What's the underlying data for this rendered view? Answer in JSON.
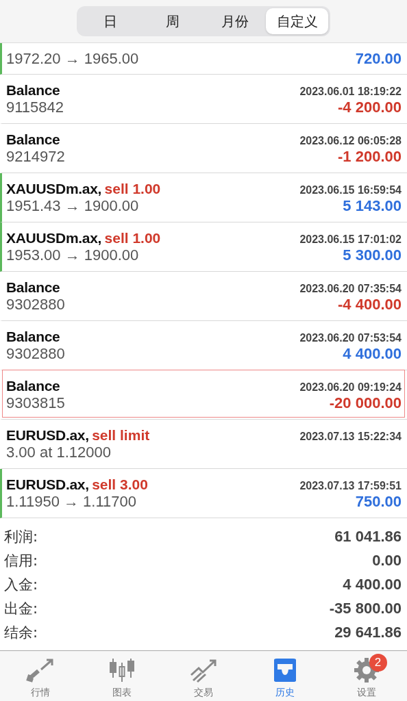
{
  "periods": [
    {
      "label": "日",
      "selected": false
    },
    {
      "label": "周",
      "selected": false
    },
    {
      "label": "月份",
      "selected": false
    },
    {
      "label": "自定义",
      "selected": true
    }
  ],
  "deals": [
    {
      "kind": "deal",
      "partial": true,
      "selected": false,
      "detail": "1972.20 → 1965.00",
      "amount": "720.00",
      "loss": false
    },
    {
      "kind": "balance",
      "selected": false,
      "symbol": "Balance",
      "time": "2023.06.01 18:19:22",
      "detail": "9115842",
      "amount": "-4 200.00",
      "loss": true
    },
    {
      "kind": "balance",
      "selected": false,
      "symbol": "Balance",
      "time": "2023.06.12 06:05:28",
      "detail": "9214972",
      "amount": "-1 200.00",
      "loss": true
    },
    {
      "kind": "deal",
      "selected": false,
      "symbol": "XAUUSDm.ax,",
      "action": "sell 1.00",
      "time": "2023.06.15 16:59:54",
      "detail": "1951.43 → 1900.00",
      "amount": "5 143.00",
      "loss": false
    },
    {
      "kind": "deal",
      "selected": false,
      "symbol": "XAUUSDm.ax,",
      "action": "sell 1.00",
      "time": "2023.06.15 17:01:02",
      "detail": "1953.00 → 1900.00",
      "amount": "5 300.00",
      "loss": false
    },
    {
      "kind": "balance",
      "selected": false,
      "symbol": "Balance",
      "time": "2023.06.20 07:35:54",
      "detail": "9302880",
      "amount": "-4 400.00",
      "loss": true
    },
    {
      "kind": "balance",
      "selected": false,
      "symbol": "Balance",
      "time": "2023.06.20 07:53:54",
      "detail": "9302880",
      "amount": "4 400.00",
      "loss": false
    },
    {
      "kind": "balance",
      "selected": true,
      "symbol": "Balance",
      "time": "2023.06.20 09:19:24",
      "detail": "9303815",
      "amount": "-20 000.00",
      "loss": true
    },
    {
      "kind": "order",
      "selected": false,
      "symbol": "EURUSD.ax,",
      "action": "sell limit",
      "time": "2023.07.13 15:22:34",
      "detail": "3.00 at 1.12000"
    },
    {
      "kind": "deal",
      "selected": false,
      "symbol": "EURUSD.ax,",
      "action": "sell 3.00",
      "time": "2023.07.13 17:59:51",
      "detail": "1.11950 → 1.11700",
      "amount": "750.00",
      "loss": false
    }
  ],
  "summary": [
    {
      "label": "利润:",
      "value": "61 041.86"
    },
    {
      "label": "信用:",
      "value": "0.00"
    },
    {
      "label": "入金:",
      "value": "4 400.00"
    },
    {
      "label": "出金:",
      "value": "-35 800.00"
    },
    {
      "label": "结余:",
      "value": "29 641.86"
    }
  ],
  "tab_bar": [
    {
      "kind": "quotes",
      "label": "行情",
      "selected": false
    },
    {
      "kind": "chart",
      "label": "图表",
      "selected": false
    },
    {
      "kind": "trade",
      "label": "交易",
      "selected": false
    },
    {
      "kind": "history",
      "label": "历史",
      "selected": true
    },
    {
      "kind": "settings",
      "label": "设置",
      "selected": false,
      "badge": "2"
    }
  ]
}
